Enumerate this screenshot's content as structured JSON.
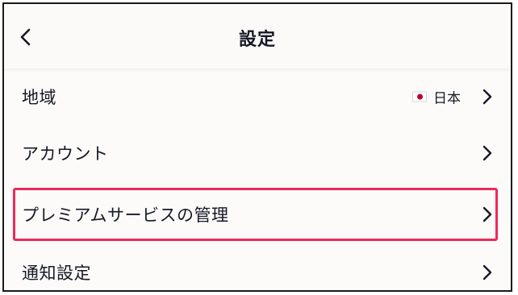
{
  "header": {
    "title": "設定",
    "back_icon": "chevron-left-icon"
  },
  "rows": [
    {
      "label": "地域",
      "value": "日本",
      "flag": "japan-flag"
    },
    {
      "label": "アカウント"
    },
    {
      "label": "プレミアムサービスの管理",
      "highlighted": true
    },
    {
      "label": "通知設定"
    }
  ],
  "colors": {
    "highlight": "#ee2a5a",
    "text": "#161823",
    "background": "#fcfbfa"
  }
}
